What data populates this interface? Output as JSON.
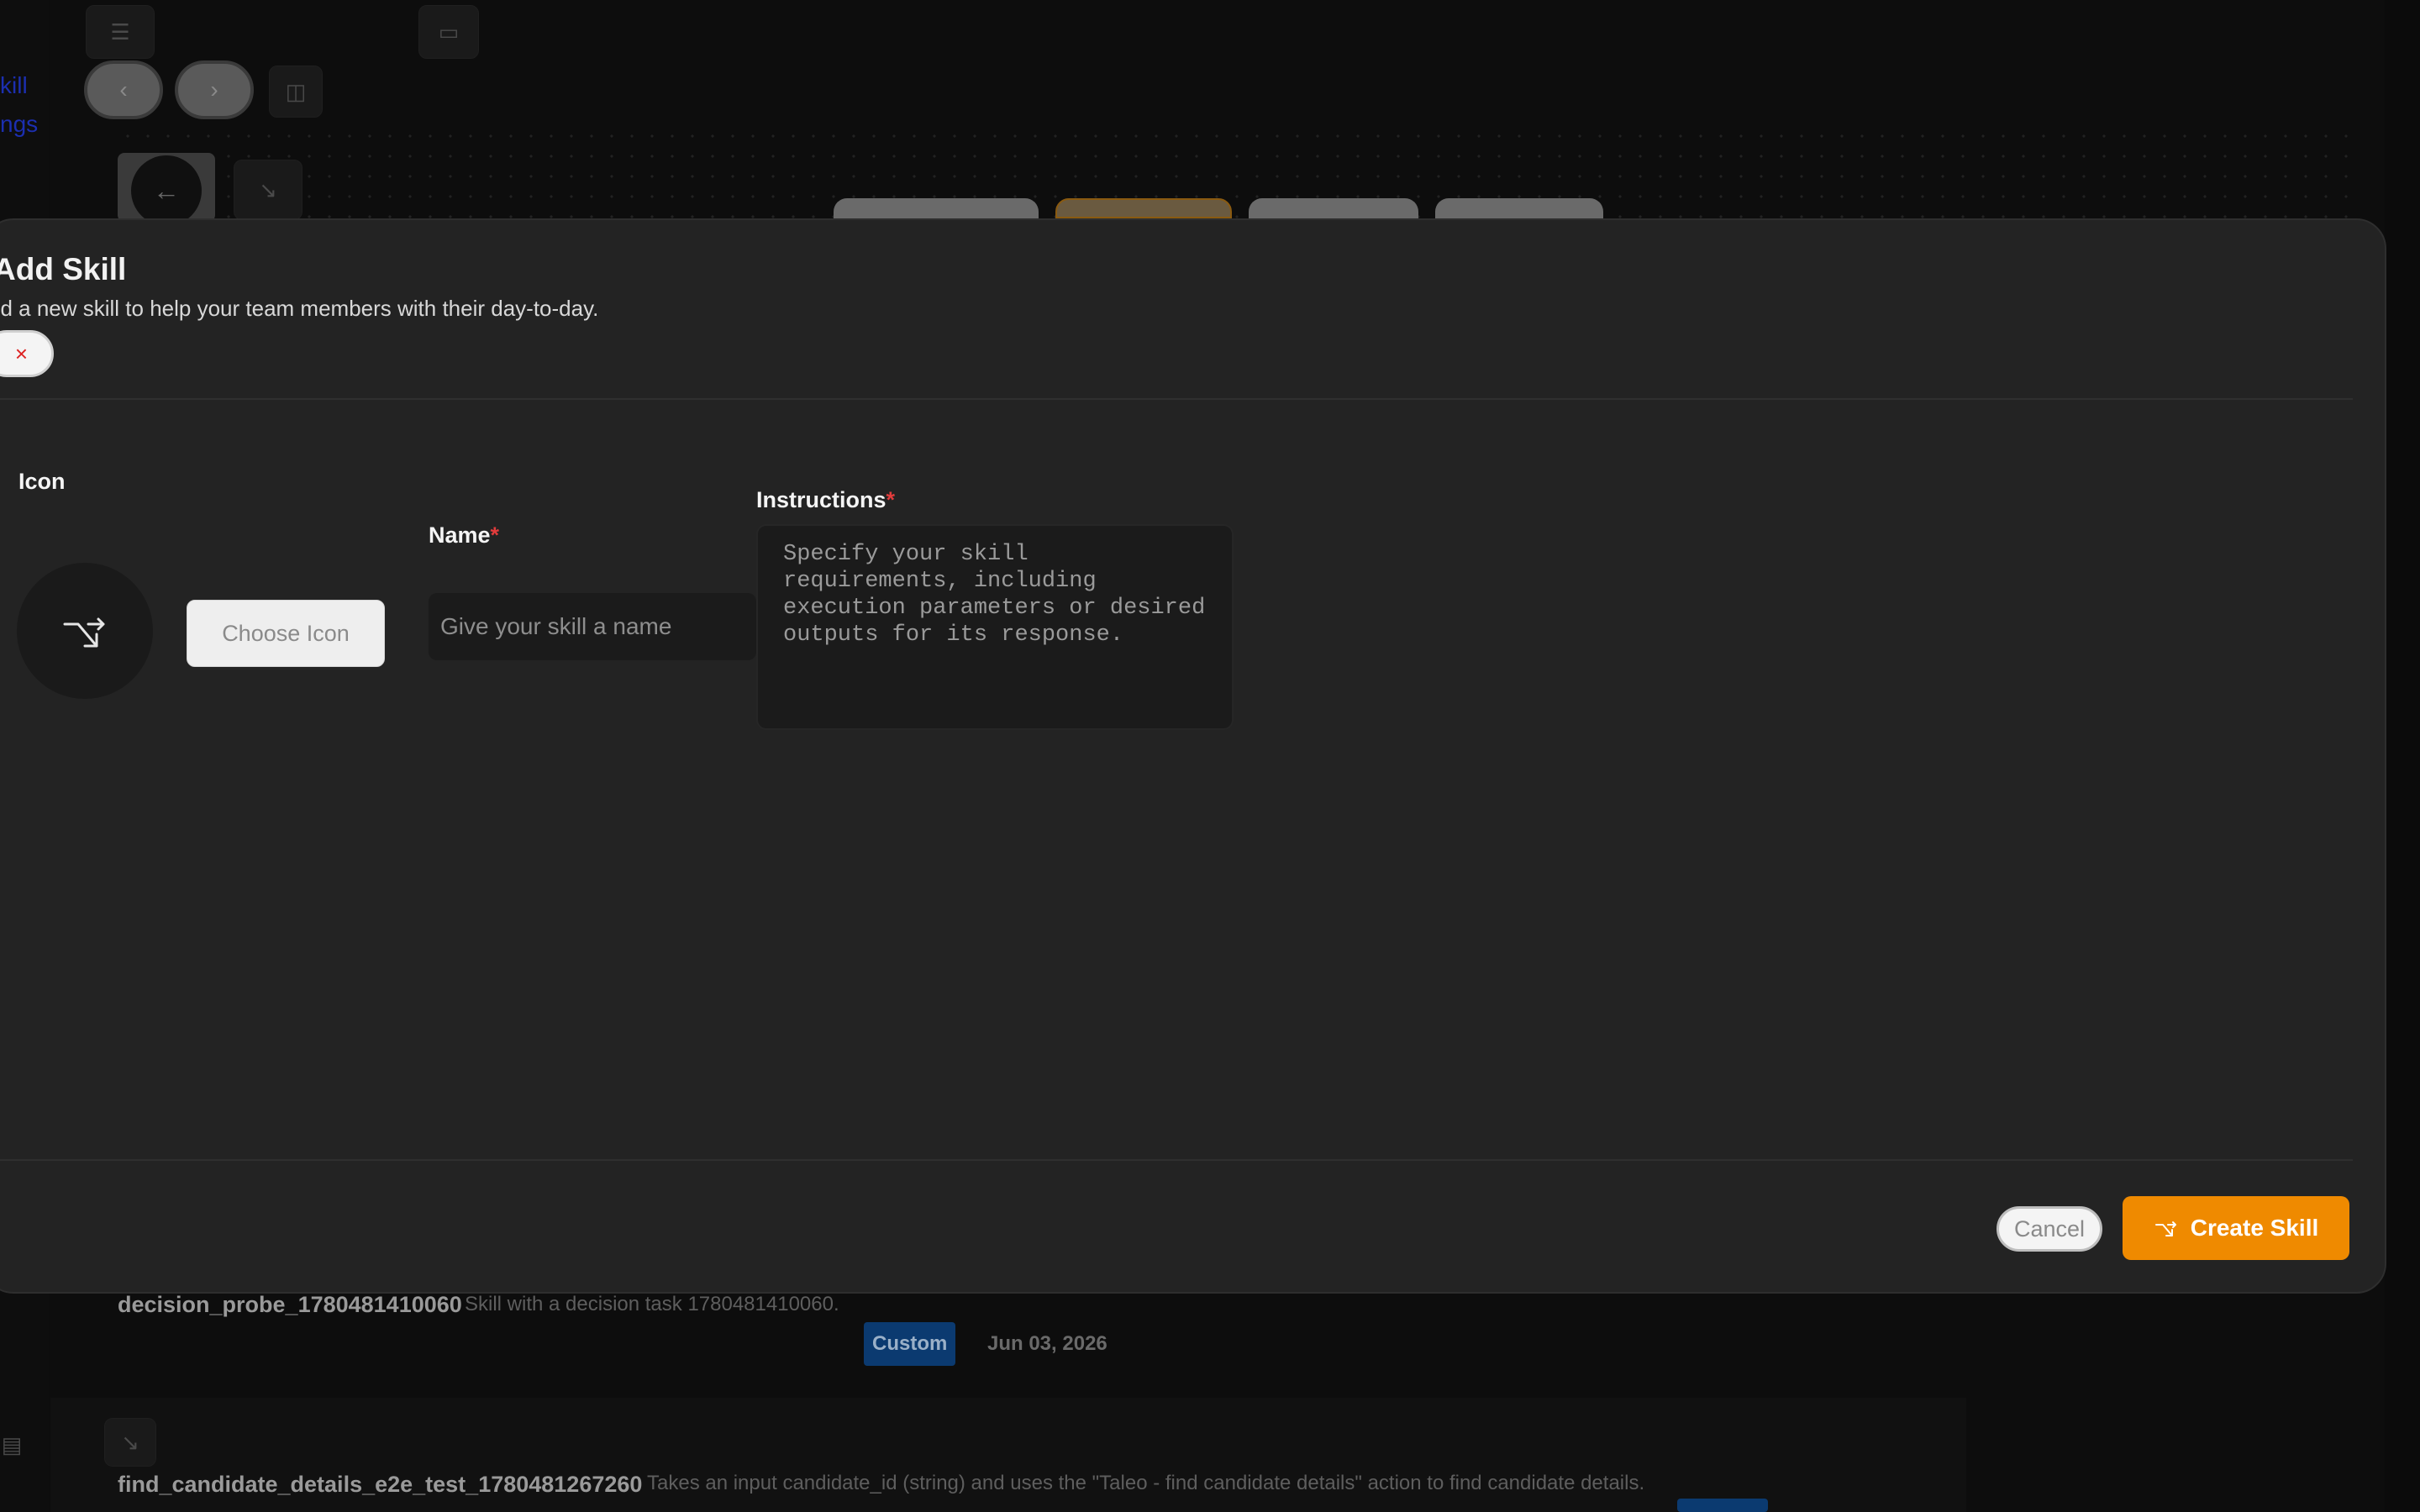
{
  "background": {
    "links": [
      "kill",
      "ngs"
    ],
    "rows": [
      {
        "title": "decision_probe_1780481410060",
        "description": "Skill with a decision task 1780481410060.",
        "badge": "Custom",
        "date": "Jun 03, 2026"
      },
      {
        "title": "find_candidate_details_e2e_test_1780481267260",
        "description": "Takes an input candidate_id (string) and uses the \"Taleo - find candidate details\" action to find candidate details."
      }
    ]
  },
  "modal": {
    "title": "Add Skill",
    "subtitle": "dd a new skill to help your team members with their day-to-day.",
    "close_icon": "close-icon",
    "icon_label": "Icon",
    "choose_icon_label": "Choose Icon",
    "name_label": "Name",
    "name_placeholder": "Give your skill a name",
    "instructions_label": "Instructions",
    "instructions_placeholder": "Specify your skill requirements, including execution parameters or desired outputs for its response.",
    "required_marker": "*",
    "cancel_label": "Cancel",
    "create_label": "Create Skill",
    "skill_icon": "skill-arrow-icon"
  },
  "colors": {
    "accent": "#ef8a00",
    "required": "#e23c3c",
    "badge": "#0b3a70"
  }
}
